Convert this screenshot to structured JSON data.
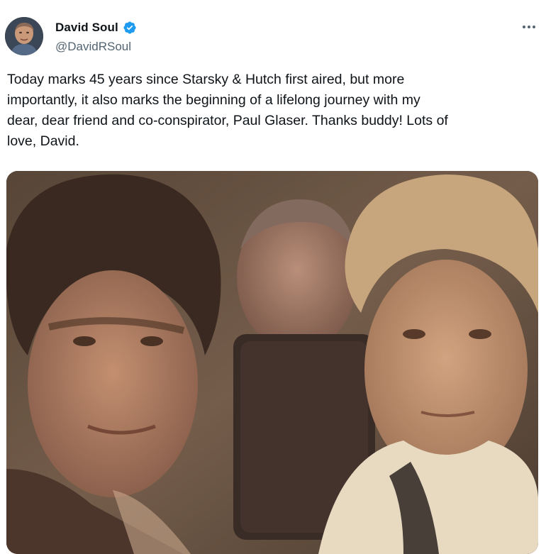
{
  "author": {
    "display_name": "David Soul",
    "handle": "@DavidRSoul",
    "verified": true,
    "avatar_icon": "profile-avatar"
  },
  "tweet": {
    "text": "Today marks 45 years since Starsky & Hutch first aired, but more\nimportantly, it also marks the beginning of a lifelong journey with my\ndear, dear friend and co-conspirator, Paul Glaser. Thanks buddy! Lots of\nlove, David."
  },
  "menu": {
    "more_icon": "more-horizontal-icon"
  },
  "media": {
    "type": "photo",
    "icon": "photo-image"
  },
  "colors": {
    "verified_badge": "#1d9bf0",
    "secondary_text": "#536471",
    "primary_text": "#0f1419"
  }
}
